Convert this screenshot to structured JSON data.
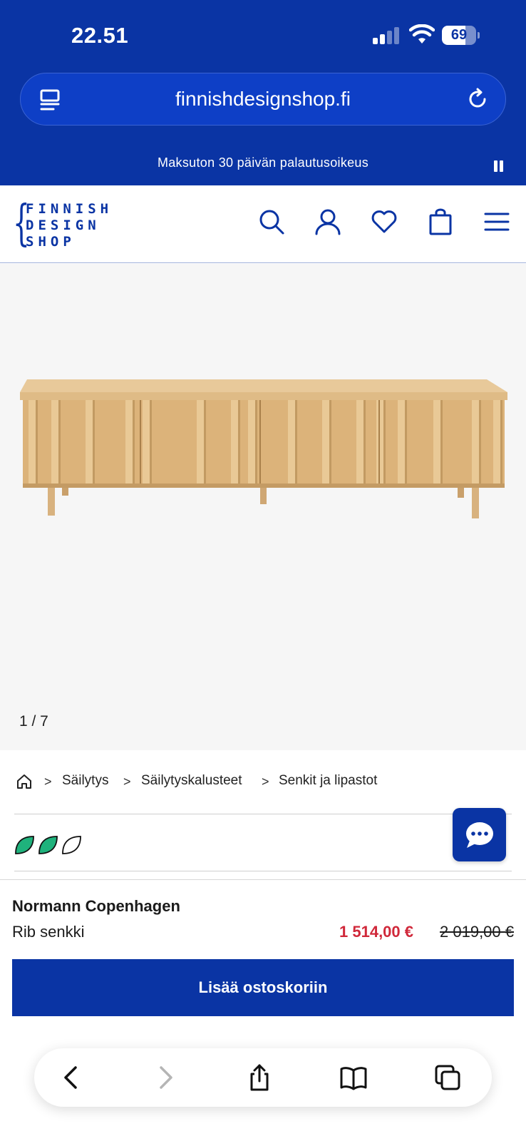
{
  "status_bar": {
    "time": "22.51",
    "battery": "69",
    "battery_level": 0.69
  },
  "browser": {
    "url": "finnishdesignshop.fi"
  },
  "promo": {
    "text": "Maksuton 30 päivän palautusoikeus"
  },
  "logo": {
    "lines": [
      "FINNISH",
      "DESIGN",
      "SHOP"
    ]
  },
  "header_icons": [
    "search-icon",
    "account-icon",
    "heart-icon",
    "bag-icon",
    "menu-icon"
  ],
  "gallery": {
    "counter": "1 / 7"
  },
  "breadcrumb": {
    "items": [
      "Säilytys",
      "Säilytyskalusteet",
      "Senkit ja lipastot"
    ],
    "separator": ">"
  },
  "sustainability": {
    "filled_leaves": 2,
    "total_leaves": 3
  },
  "product": {
    "brand": "Normann Copenhagen",
    "name": "Rib senkki",
    "price_sale": "1 514,00 €",
    "price_original": "2 019,00 €",
    "add_to_cart": "Lisää ostoskoriin"
  },
  "colors": {
    "brand_blue": "#0a34a4",
    "sale_red": "#d0283a",
    "leaf_green": "#1fb27c"
  }
}
